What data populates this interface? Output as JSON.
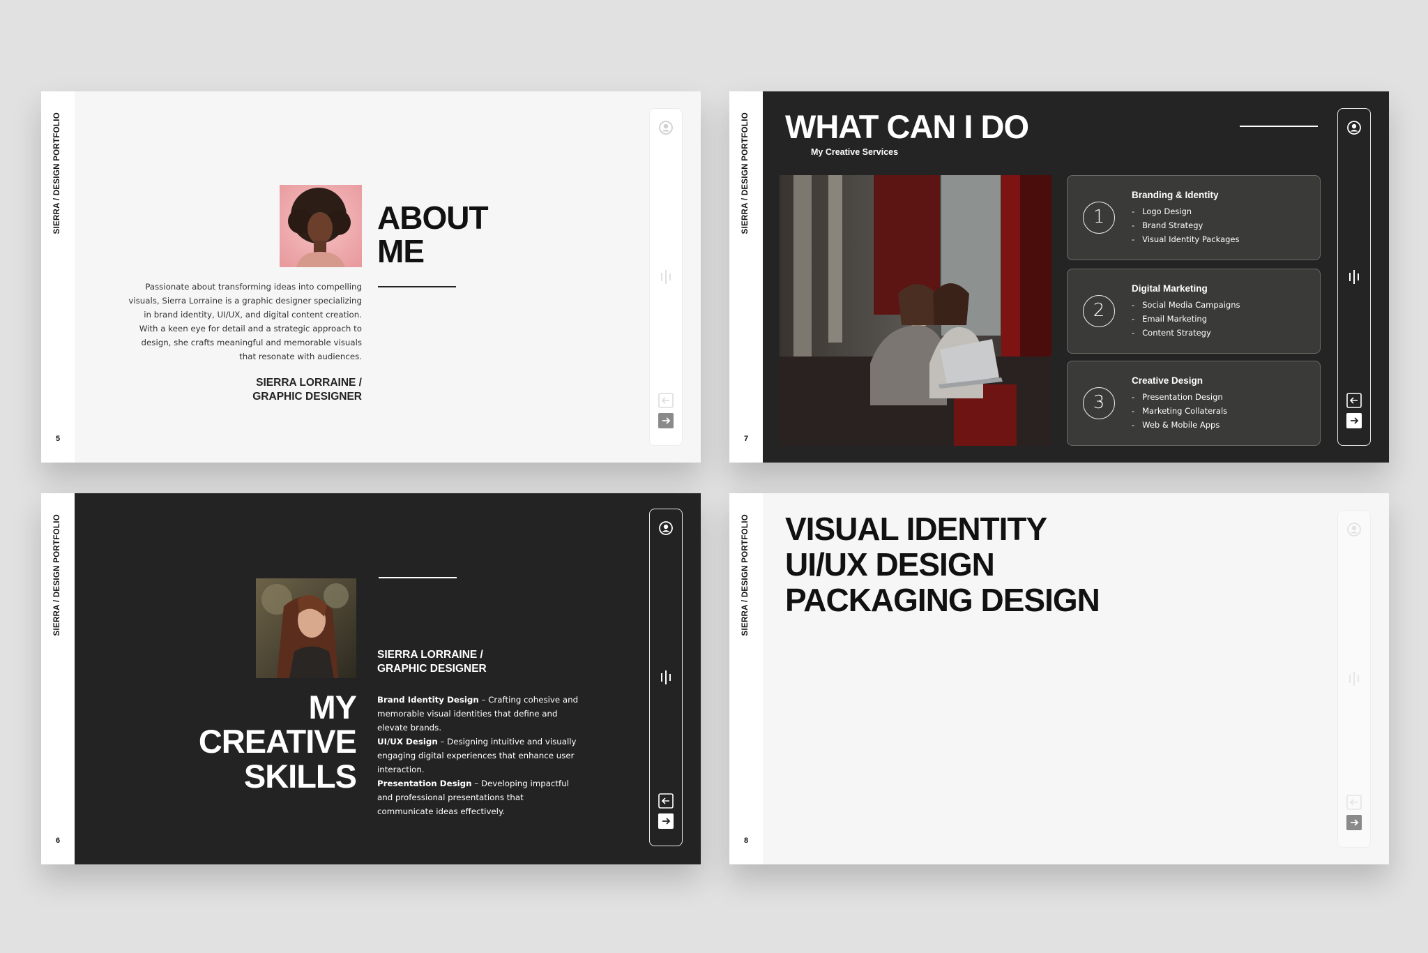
{
  "side_label": "SIERRA / DESIGN PORTFOLIO",
  "slides": {
    "s5": {
      "page": "5",
      "title_line1": "ABOUT",
      "title_line2": "ME",
      "bio": "Passionate about transforming ideas into compelling visuals, Sierra Lorraine is a graphic designer specializing in brand identity, UI/UX, and digital content creation. With a keen eye for detail and a strategic approach to design, she crafts meaningful and memorable visuals that resonate with audiences.",
      "sig_line1": "SIERRA LORRAINE /",
      "sig_line2": "GRAPHIC DESIGNER"
    },
    "s7": {
      "page": "7",
      "title": "WHAT CAN I DO",
      "subtitle": "My Creative Services",
      "services": [
        {
          "num": "1",
          "title": "Branding & Identity",
          "items": [
            "Logo Design",
            "Brand Strategy",
            "Visual Identity Packages"
          ]
        },
        {
          "num": "2",
          "title": "Digital Marketing",
          "items": [
            "Social Media Campaigns",
            "Email Marketing",
            "Content Strategy"
          ]
        },
        {
          "num": "3",
          "title": "Creative Design",
          "items": [
            "Presentation Design",
            "Marketing Collaterals",
            "Web & Mobile Apps"
          ]
        }
      ]
    },
    "s6": {
      "page": "6",
      "title_line1": "MY",
      "title_line2": "CREATIVE",
      "title_line3": "SKILLS",
      "sig_line1": "SIERRA LORRAINE /",
      "sig_line2": "GRAPHIC DESIGNER",
      "skills": [
        {
          "name": "Brand Identity Design",
          "desc": " – Crafting cohesive and memorable visual identities that define and elevate brands."
        },
        {
          "name": "UI/UX Design",
          "desc": " – Designing intuitive and visually engaging digital experiences that enhance user interaction."
        },
        {
          "name": "Presentation Design",
          "desc": " – Developing impactful and professional presentations that communicate ideas effectively."
        }
      ]
    },
    "s8": {
      "page": "8",
      "line1": "VISUAL IDENTITY",
      "line2": "UI/UX DESIGN",
      "line3": "PACKAGING DESIGN"
    }
  },
  "icons": {
    "user": "user-circle-icon",
    "bars": "audio-bars-icon",
    "prev": "arrow-left-icon",
    "next": "arrow-right-icon"
  },
  "colors": {
    "background": "#e1e1e1",
    "dark_slide": "#242424",
    "light_slide": "#f6f6f6",
    "card": "#3a3a38"
  }
}
